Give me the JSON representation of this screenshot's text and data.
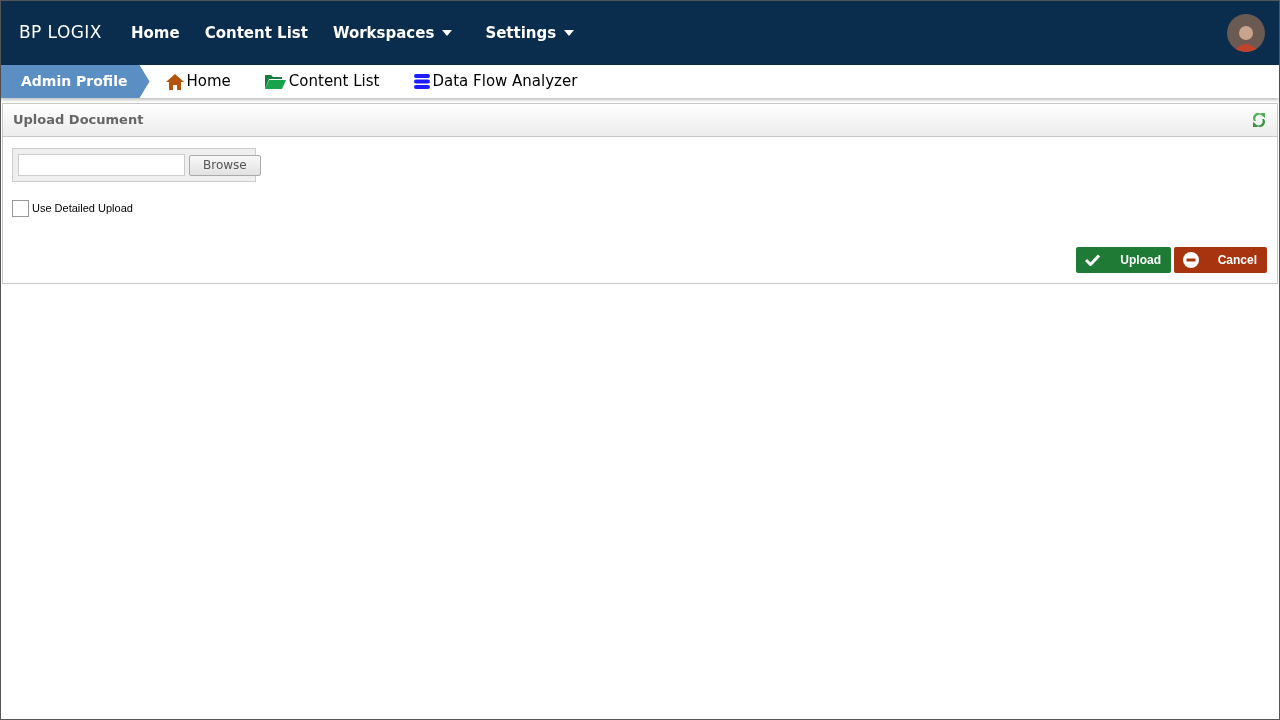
{
  "header": {
    "logo": "BP LOGIX",
    "nav": [
      {
        "label": "Home",
        "kind": "link"
      },
      {
        "label": "Content List",
        "kind": "link"
      },
      {
        "label": "Workspaces",
        "kind": "dropdown"
      },
      {
        "label": "Settings",
        "kind": "dropdown"
      }
    ]
  },
  "breadcrumb": {
    "current": "Admin Profile",
    "links": [
      {
        "label": "Home",
        "kind": "home"
      },
      {
        "label": "Content List",
        "kind": "list"
      },
      {
        "label": "Data Flow Analyzer",
        "kind": "tool"
      }
    ]
  },
  "panel": {
    "title": "Upload Document",
    "file_button": "Browse",
    "detailed_upload": {
      "label": "Use Detailed Upload",
      "checked": false
    },
    "buttons": [
      {
        "label": "Upload",
        "kind": "confirm"
      },
      {
        "label": "Cancel",
        "kind": "cancel"
      }
    ]
  }
}
